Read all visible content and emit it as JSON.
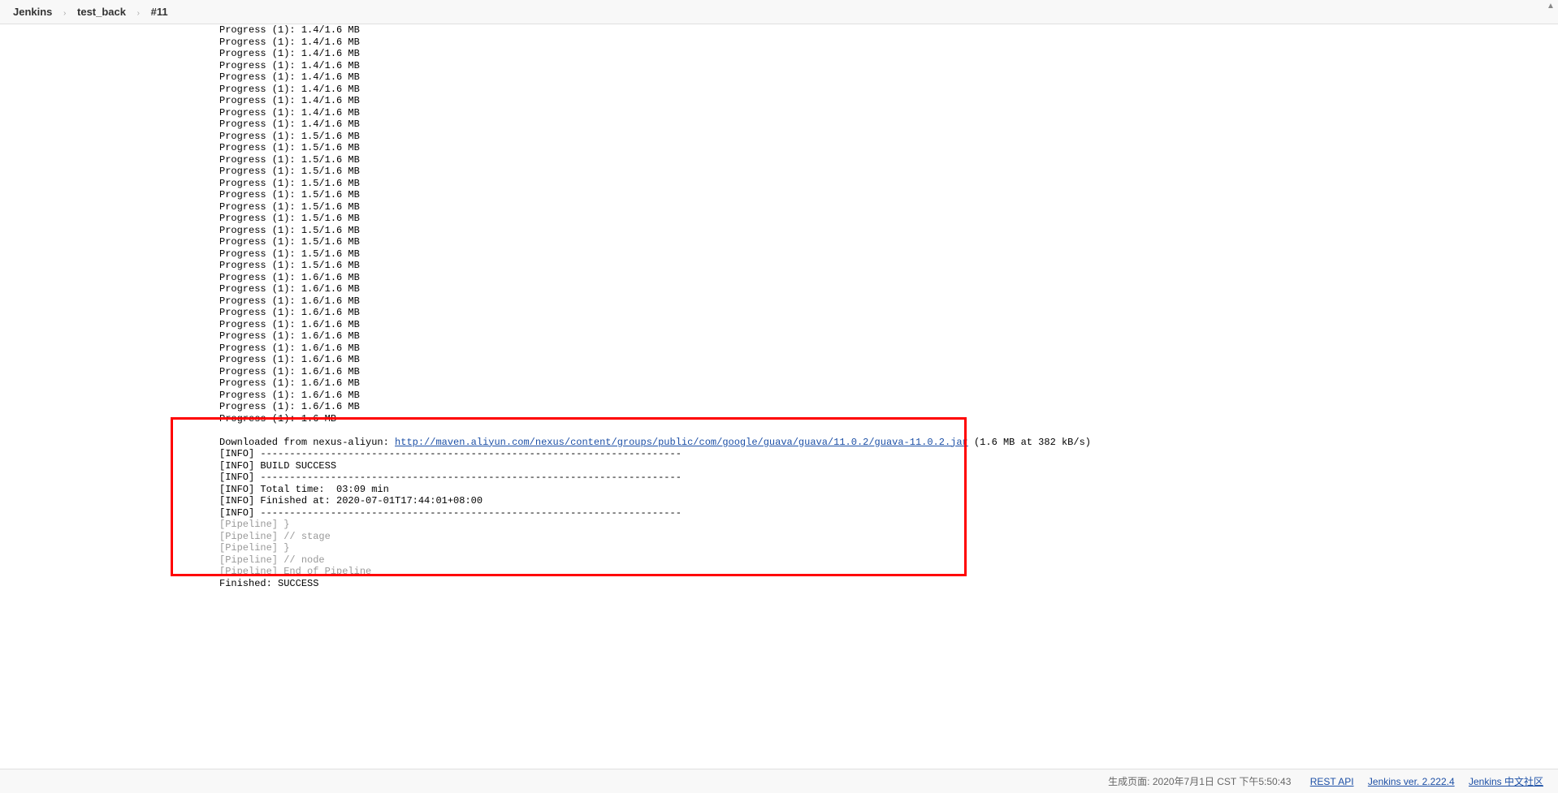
{
  "breadcrumb": {
    "jenkins": "Jenkins",
    "job": "test_back",
    "build": "#11"
  },
  "console": {
    "progress_14": "Progress (1): 1.4/1.6 MB",
    "progress_15": "Progress (1): 1.5/1.6 MB",
    "progress_16": "Progress (1): 1.6/1.6 MB",
    "progress_final": "Progress (1): 1.6 MB",
    "downloaded_prefix": "Downloaded from nexus-aliyun: ",
    "downloaded_url": "http://maven.aliyun.com/nexus/content/groups/public/com/google/guava/guava/11.0.2/guava-11.0.2.jar",
    "downloaded_suffix": " (1.6 MB at 382 kB/s)",
    "info_divider": "[INFO] ------------------------------------------------------------------------",
    "build_success": "[INFO] BUILD SUCCESS",
    "total_time": "[INFO] Total time:  03:09 min",
    "finished_at": "[INFO] Finished at: 2020-07-01T17:44:01+08:00",
    "pipeline_brace": "[Pipeline] }",
    "pipeline_stage": "[Pipeline] // stage",
    "pipeline_node": "[Pipeline] // node",
    "pipeline_end": "[Pipeline] End of Pipeline",
    "finished": "Finished: SUCCESS"
  },
  "footer": {
    "timestamp_label": "生成页面:",
    "timestamp": "2020年7月1日 CST 下午5:50:43",
    "rest_api": "REST API",
    "version": "Jenkins ver. 2.222.4",
    "community": "Jenkins 中文社区"
  }
}
